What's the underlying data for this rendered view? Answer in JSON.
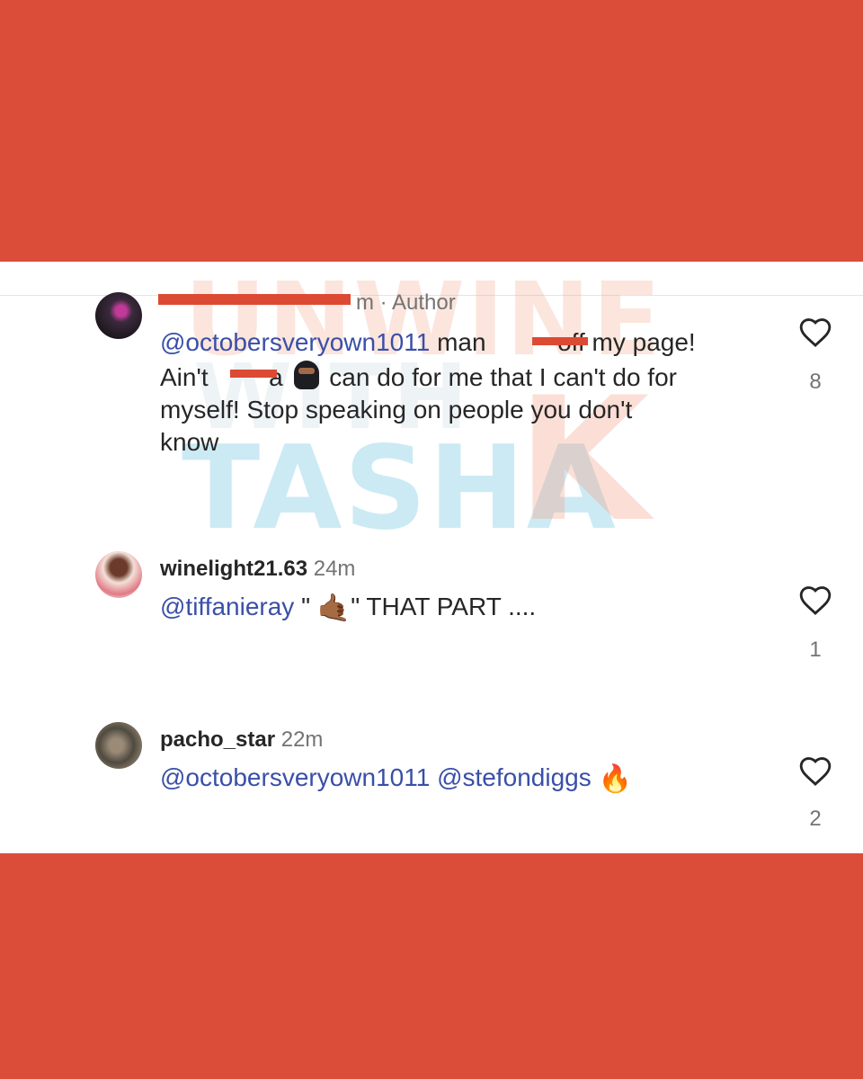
{
  "comments": [
    {
      "username_suffix": "m",
      "badge": "Author",
      "separator": "·",
      "mention": "@octobersveryown1011",
      "line1_rest_a": "man",
      "line1_rest_b": "off my page!",
      "line2_a": "Ain't",
      "line2_b": "a",
      "line2_c": "can do for me that I can't do for",
      "line3": "myself! Stop speaking on people you don't",
      "line4": "know",
      "likes": "8"
    },
    {
      "username": "winelight21.63",
      "time": "24m",
      "mention": "@tiffanieray",
      "quote_open": "\"",
      "emoji": "🤙🏾",
      "quote_close": "\" THAT PART ....",
      "likes": "1"
    },
    {
      "username": "pacho_star",
      "time": "22m",
      "mention1": "@octobersveryown1011",
      "mention2": "@stefondiggs",
      "emoji": "🔥",
      "likes": "2"
    }
  ],
  "watermark": {
    "line1": "UNWINE",
    "line2": "WITH",
    "line3": "TASHA",
    "line4": "K"
  },
  "colors": {
    "background": "#db4d38",
    "mention": "#3a4fa8",
    "text": "#262626",
    "muted": "#737373",
    "redaction": "#dc4a33"
  }
}
